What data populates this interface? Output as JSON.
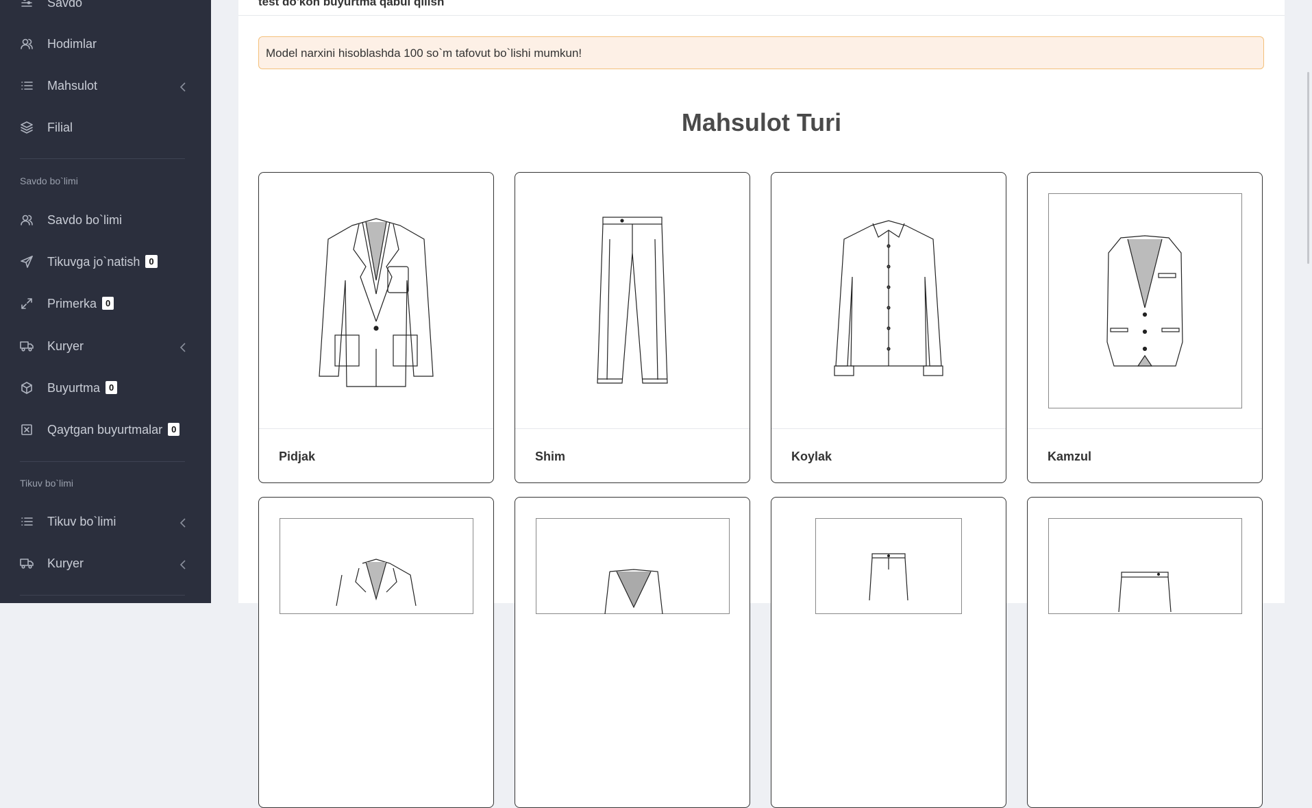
{
  "sidebar": {
    "items_top": [
      {
        "label": "Savdo"
      },
      {
        "label": "Hodimlar"
      },
      {
        "label": "Mahsulot"
      },
      {
        "label": "Filial"
      }
    ],
    "section_savdo": "Savdo bo`limi",
    "items_savdo": [
      {
        "label": "Savdo bo`limi"
      },
      {
        "label": "Tikuvga jo`natish",
        "badge": "0"
      },
      {
        "label": "Primerka",
        "badge": "0"
      },
      {
        "label": "Kuryer"
      },
      {
        "label": "Buyurtma",
        "badge": "0"
      },
      {
        "label": "Qaytgan buyurtmalar",
        "badge": "0"
      }
    ],
    "section_tikuv": "Tikuv bo`limi",
    "items_tikuv": [
      {
        "label": "Tikuv bo`limi"
      },
      {
        "label": "Kuryer"
      }
    ]
  },
  "main": {
    "top_notice": "test do'kon buyurtma qabul qilish",
    "alert": "Model narxini hisoblashda 100 so`m tafovut bo`lishi mumkun!",
    "title": "Mahsulot Turi",
    "products": [
      {
        "name": "Pidjak"
      },
      {
        "name": "Shim"
      },
      {
        "name": "Koylak"
      },
      {
        "name": "Kamzul"
      }
    ]
  }
}
